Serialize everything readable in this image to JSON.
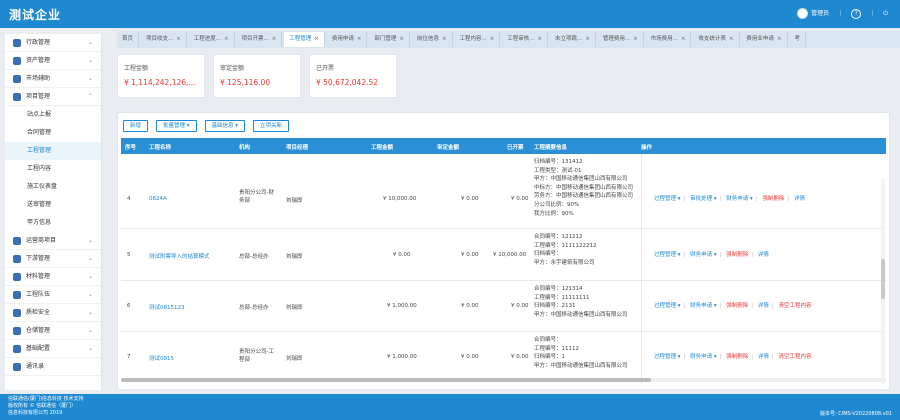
{
  "header": {
    "brand": "测试企业",
    "user": "管理员",
    "help_icon": "?"
  },
  "sidebar": {
    "items": [
      {
        "label": "行政管理",
        "icon": "admin-icon",
        "expanded": false
      },
      {
        "label": "资产管理",
        "icon": "asset-icon",
        "expanded": false
      },
      {
        "label": "市场辅助",
        "icon": "market-icon",
        "expanded": false
      },
      {
        "label": "项目管理",
        "icon": "project-icon",
        "expanded": true
      }
    ],
    "sub_items": [
      "站点上报",
      "合同管理",
      "工程管理",
      "工程内容",
      "施工仪表盘",
      "送审管理",
      "甲方信息"
    ],
    "active_sub": "工程管理",
    "bottom_items": [
      {
        "label": "运营商项目",
        "icon": "operator-icon"
      },
      {
        "label": "下游管理",
        "icon": "downstream-icon"
      },
      {
        "label": "材料管理",
        "icon": "material-icon"
      },
      {
        "label": "工程队伍",
        "icon": "team-icon"
      },
      {
        "label": "质检安全",
        "icon": "safety-icon"
      },
      {
        "label": "仓储管理",
        "icon": "storage-icon"
      },
      {
        "label": "基础配置",
        "icon": "config-icon"
      },
      {
        "label": "通讯录",
        "icon": "contacts-icon"
      }
    ]
  },
  "tabs": [
    "首页",
    "项目收支...",
    "工程进度...",
    "项目开票...",
    "工程管理",
    "费用申请",
    "部门管理",
    "岗位信息",
    "工程内容...",
    "工程审核...",
    "未立项跳...",
    "管理费用...",
    "市场费用...",
    "收支统计表",
    "费用业申请",
    "考"
  ],
  "active_tab": "工程管理",
  "cards": [
    {
      "label": "工程金额",
      "value": "¥ 1,114,242,126,..."
    },
    {
      "label": "审定金额",
      "value": "¥ 125,116.00"
    },
    {
      "label": "已开票",
      "value": "¥ 50,672,042.52"
    }
  ],
  "toolbar": {
    "add": "新增",
    "batch": "批量管理 ▾",
    "base_info": "基础信息 ▾",
    "close": "立项关新"
  },
  "table": {
    "headers": [
      "序号",
      "工程名称",
      "机构",
      "项目经理",
      "工程金额",
      "审定金额",
      "已开票",
      "工程摘要信息",
      "操作"
    ],
    "rows": [
      {
        "no": "4",
        "name": "0824A",
        "org": "贵阳分公司-财务部",
        "pm": "刘瑞即",
        "amount": "¥ 10,000.00",
        "approved": "¥ 0.00",
        "invoiced": "¥ 0.00",
        "info": [
          "归档编号：131412",
          "工程类型：测试-01",
          "甲方：中国移动通信集团山西有限公司",
          "中标方：中国移动通信集团山西有限公司",
          "劳务方：中国移动通信集团山西有限公司",
          "分公司比例：90%",
          "我方比例：90%"
        ],
        "ops": [
          "过程管理 ▾",
          "审批处理 ▾",
          "财务申请 ▾",
          "强制删除",
          "详情"
        ]
      },
      {
        "no": "5",
        "name": "测试附票导入的结算模式",
        "org": "总部-总经办",
        "pm": "刘瑞即",
        "amount": "¥ 0.00",
        "approved": "¥ 0.00",
        "invoiced": "¥ 10,000.00",
        "info": [
          "合同编号：121212",
          "工程编号：1111122212",
          "归档编号：",
          "甲方：永宇建筑有限公司"
        ],
        "ops": [
          "过程管理 ▾",
          "财务申请 ▾",
          "强制删除",
          "详情"
        ]
      },
      {
        "no": "6",
        "name": "测试0815123",
        "org": "总部-总经办",
        "pm": "刘瑞即",
        "amount": "¥ 1,000.00",
        "approved": "¥ 0.00",
        "invoiced": "¥ 0.00",
        "info": [
          "合同编号：121314",
          "工程编号：11111111",
          "归档编号：2131",
          "甲方：中国移动通信集团山西有限公司"
        ],
        "ops": [
          "过程管理 ▾",
          "财务申请 ▾",
          "强制删除",
          "详情",
          "清空工程内容"
        ]
      },
      {
        "no": "7",
        "name": "测试0815",
        "org": "贵阳分公司-工程部",
        "pm": "刘瑞即",
        "amount": "¥ 1,000.00",
        "approved": "¥ 0.00",
        "invoiced": "¥ 0.00",
        "info": [
          "合同编号：",
          "工程编号：11112",
          "归档编号：1",
          "甲方：中国移动通信集团山西有限公司"
        ],
        "ops": [
          "过程管理 ▾",
          "财务申请 ▾",
          "强制删除",
          "详情",
          "清空工程内容"
        ]
      }
    ]
  },
  "footer": {
    "line1": "信联通信(厦门)信息科技 技术支持",
    "line2": "版权所有 © 信联通信（厦门）",
    "line3": "信息科技有限公司 2019",
    "version": "版本号: CIMS-V20220808.v01"
  },
  "colors": {
    "primary": "#1e88d0",
    "danger": "#e53a3a",
    "table_header": "#2b8fd6"
  }
}
